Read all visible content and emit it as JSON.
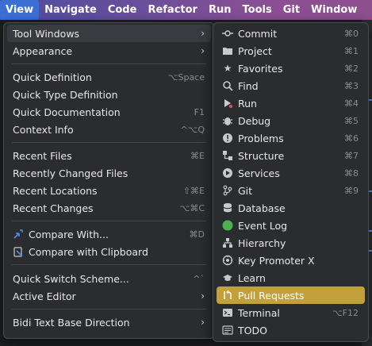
{
  "menubar": [
    "View",
    "Navigate",
    "Code",
    "Refactor",
    "Run",
    "Tools",
    "Git",
    "Window"
  ],
  "view_menu": {
    "items": [
      {
        "label": "Tool Windows",
        "shortcut": "",
        "submenu": true
      },
      {
        "label": "Appearance",
        "shortcut": "",
        "submenu": true
      },
      {
        "label": "Quick Definition",
        "shortcut": "⌥Space"
      },
      {
        "label": "Quick Type Definition",
        "shortcut": ""
      },
      {
        "label": "Quick Documentation",
        "shortcut": "F1"
      },
      {
        "label": "Context Info",
        "shortcut": "^⌥Q"
      },
      {
        "label": "Recent Files",
        "shortcut": "⌘E"
      },
      {
        "label": "Recently Changed Files",
        "shortcut": ""
      },
      {
        "label": "Recent Locations",
        "shortcut": "⇧⌘E"
      },
      {
        "label": "Recent Changes",
        "shortcut": "⌥⌘C"
      },
      {
        "label": "Compare With...",
        "shortcut": "⌘D",
        "icon": "compare-icon"
      },
      {
        "label": "Compare with Clipboard",
        "shortcut": "",
        "icon": "clipboard-compare-icon"
      },
      {
        "label": "Quick Switch Scheme...",
        "shortcut": "^`"
      },
      {
        "label": "Active Editor",
        "shortcut": "",
        "submenu": true
      },
      {
        "label": "Bidi Text Base Direction",
        "shortcut": "",
        "submenu": true
      }
    ]
  },
  "tool_windows_menu": {
    "items": [
      {
        "label": "Commit",
        "shortcut": "⌘0",
        "icon": "commit-icon"
      },
      {
        "label": "Project",
        "shortcut": "⌘1",
        "icon": "folder-icon"
      },
      {
        "label": "Favorites",
        "shortcut": "⌘2",
        "icon": "star-icon"
      },
      {
        "label": "Find",
        "shortcut": "⌘3",
        "icon": "search-icon"
      },
      {
        "label": "Run",
        "shortcut": "⌘4",
        "icon": "run-icon"
      },
      {
        "label": "Debug",
        "shortcut": "⌘5",
        "icon": "bug-icon"
      },
      {
        "label": "Problems",
        "shortcut": "⌘6",
        "icon": "problems-icon"
      },
      {
        "label": "Structure",
        "shortcut": "⌘7",
        "icon": "structure-icon"
      },
      {
        "label": "Services",
        "shortcut": "⌘8",
        "icon": "services-icon"
      },
      {
        "label": "Git",
        "shortcut": "⌘9",
        "icon": "git-icon"
      },
      {
        "label": "Database",
        "shortcut": "",
        "icon": "database-icon"
      },
      {
        "label": "Event Log",
        "shortcut": "",
        "icon": "event-log-icon"
      },
      {
        "label": "Hierarchy",
        "shortcut": "",
        "icon": "hierarchy-icon"
      },
      {
        "label": "Key Promoter X",
        "shortcut": "",
        "icon": "key-promoter-icon"
      },
      {
        "label": "Learn",
        "shortcut": "",
        "icon": "learn-icon"
      },
      {
        "label": "Pull Requests",
        "shortcut": "",
        "icon": "pull-request-icon"
      },
      {
        "label": "Terminal",
        "shortcut": "⌥F12",
        "icon": "terminal-icon"
      },
      {
        "label": "TODO",
        "shortcut": "",
        "icon": "todo-icon"
      }
    ],
    "highlighted": "Pull Requests"
  },
  "colors": {
    "menubar_active": "#3c6fd6",
    "highlight": "#c2a13a",
    "menu_bg": "#2b2c2f"
  }
}
